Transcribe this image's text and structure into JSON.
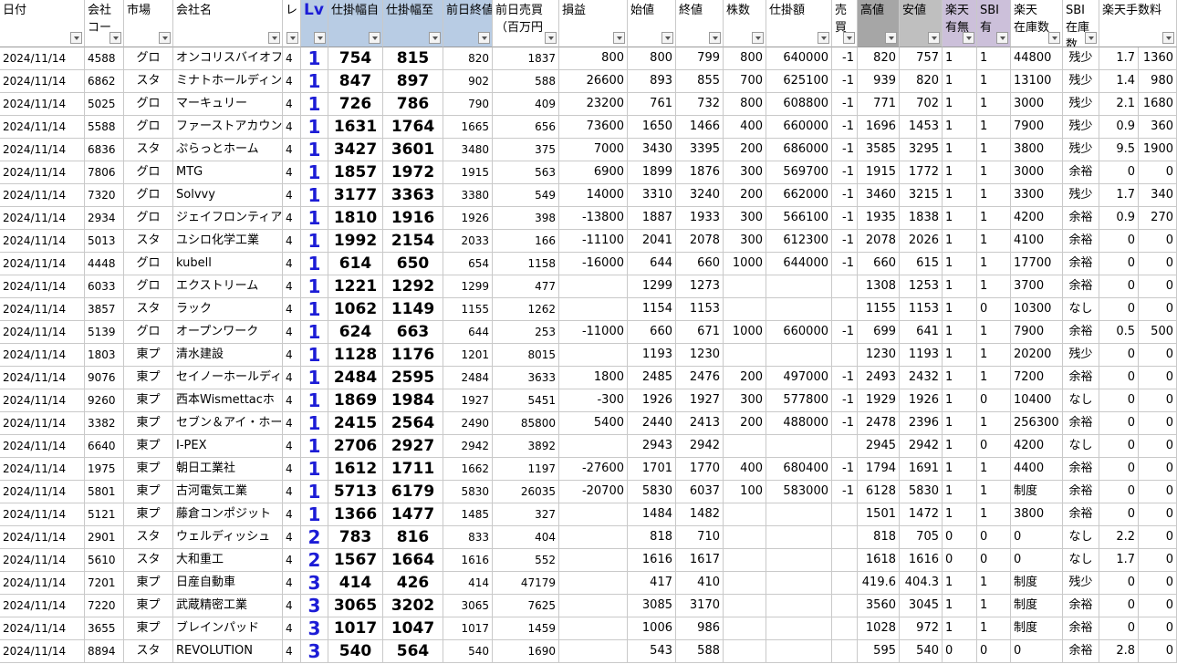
{
  "headers": [
    {
      "l1": "日付",
      "l2": ""
    },
    {
      "l1": "会社",
      "l2": "コー"
    },
    {
      "l1": "市場",
      "l2": ""
    },
    {
      "l1": "会社名",
      "l2": ""
    },
    {
      "l1": "レ",
      "l2": ""
    },
    {
      "l1": "Lv",
      "l2": ""
    },
    {
      "l1": "仕掛幅自",
      "l2": ""
    },
    {
      "l1": "仕掛幅至",
      "l2": ""
    },
    {
      "l1": "前日終値",
      "l2": ""
    },
    {
      "l1": "前日売買",
      "l2": "（百万円"
    },
    {
      "l1": "損益",
      "l2": ""
    },
    {
      "l1": "始値",
      "l2": ""
    },
    {
      "l1": "終値",
      "l2": ""
    },
    {
      "l1": "株数",
      "l2": ""
    },
    {
      "l1": "仕掛額",
      "l2": ""
    },
    {
      "l1": "売",
      "l2": "買"
    },
    {
      "l1": "高値",
      "l2": ""
    },
    {
      "l1": "安値",
      "l2": ""
    },
    {
      "l1": "楽天",
      "l2": "有無"
    },
    {
      "l1": "SBI",
      "l2": "有"
    },
    {
      "l1": "楽天",
      "l2": "在庫数"
    },
    {
      "l1": "SBI",
      "l2": "在庫",
      "l3": "数"
    },
    {
      "l1": "楽天手数料",
      "l2": ""
    }
  ],
  "rows": [
    [
      "2024/11/14",
      "4588",
      "グロ",
      "オンコリスバイオファ",
      "4",
      "1",
      "754",
      "815",
      "820",
      "1837",
      "800",
      "800",
      "799",
      "800",
      "640000",
      "-1",
      "820",
      "757",
      "1",
      "1",
      "44800",
      "残少",
      "1.7",
      "1360"
    ],
    [
      "2024/11/14",
      "6862",
      "スタ",
      "ミナトホールディン",
      "4",
      "1",
      "847",
      "897",
      "902",
      "588",
      "26600",
      "893",
      "855",
      "700",
      "625100",
      "-1",
      "939",
      "820",
      "1",
      "1",
      "13100",
      "残少",
      "1.4",
      "980"
    ],
    [
      "2024/11/14",
      "5025",
      "グロ",
      "マーキュリー",
      "4",
      "1",
      "726",
      "786",
      "790",
      "409",
      "23200",
      "761",
      "732",
      "800",
      "608800",
      "-1",
      "771",
      "702",
      "1",
      "1",
      "3000",
      "残少",
      "2.1",
      "1680"
    ],
    [
      "2024/11/14",
      "5588",
      "グロ",
      "ファーストアカウン",
      "4",
      "1",
      "1631",
      "1764",
      "1665",
      "656",
      "73600",
      "1650",
      "1466",
      "400",
      "660000",
      "-1",
      "1696",
      "1453",
      "1",
      "1",
      "7900",
      "残少",
      "0.9",
      "360"
    ],
    [
      "2024/11/14",
      "6836",
      "スタ",
      "ぷらっとホーム",
      "4",
      "1",
      "3427",
      "3601",
      "3480",
      "375",
      "7000",
      "3430",
      "3395",
      "200",
      "686000",
      "-1",
      "3585",
      "3295",
      "1",
      "1",
      "3800",
      "残少",
      "9.5",
      "1900"
    ],
    [
      "2024/11/14",
      "7806",
      "グロ",
      "MTG",
      "4",
      "1",
      "1857",
      "1972",
      "1915",
      "563",
      "6900",
      "1899",
      "1876",
      "300",
      "569700",
      "-1",
      "1915",
      "1772",
      "1",
      "1",
      "3000",
      "余裕",
      "0",
      "0"
    ],
    [
      "2024/11/14",
      "7320",
      "グロ",
      "Solvvy",
      "4",
      "1",
      "3177",
      "3363",
      "3380",
      "549",
      "14000",
      "3310",
      "3240",
      "200",
      "662000",
      "-1",
      "3460",
      "3215",
      "1",
      "1",
      "3300",
      "残少",
      "1.7",
      "340"
    ],
    [
      "2024/11/14",
      "2934",
      "グロ",
      "ジェイフロンティア",
      "4",
      "1",
      "1810",
      "1916",
      "1926",
      "398",
      "-13800",
      "1887",
      "1933",
      "300",
      "566100",
      "-1",
      "1935",
      "1838",
      "1",
      "1",
      "4200",
      "余裕",
      "0.9",
      "270"
    ],
    [
      "2024/11/14",
      "5013",
      "スタ",
      "ユシロ化学工業",
      "4",
      "1",
      "1992",
      "2154",
      "2033",
      "166",
      "-11100",
      "2041",
      "2078",
      "300",
      "612300",
      "-1",
      "2078",
      "2026",
      "1",
      "1",
      "4100",
      "余裕",
      "0",
      "0"
    ],
    [
      "2024/11/14",
      "4448",
      "グロ",
      "kubell",
      "4",
      "1",
      "614",
      "650",
      "654",
      "1158",
      "-16000",
      "644",
      "660",
      "1000",
      "644000",
      "-1",
      "660",
      "615",
      "1",
      "1",
      "17700",
      "余裕",
      "0",
      "0"
    ],
    [
      "2024/11/14",
      "6033",
      "グロ",
      "エクストリーム",
      "4",
      "1",
      "1221",
      "1292",
      "1299",
      "477",
      "",
      "1299",
      "1273",
      "",
      "",
      "",
      "1308",
      "1253",
      "1",
      "1",
      "3700",
      "余裕",
      "0",
      "0"
    ],
    [
      "2024/11/14",
      "3857",
      "スタ",
      "ラック",
      "4",
      "1",
      "1062",
      "1149",
      "1155",
      "1262",
      "",
      "1154",
      "1153",
      "",
      "",
      "",
      "1155",
      "1153",
      "1",
      "0",
      "10300",
      "なし",
      "0",
      "0"
    ],
    [
      "2024/11/14",
      "5139",
      "グロ",
      "オープンワーク",
      "4",
      "1",
      "624",
      "663",
      "644",
      "253",
      "-11000",
      "660",
      "671",
      "1000",
      "660000",
      "-1",
      "699",
      "641",
      "1",
      "1",
      "7900",
      "余裕",
      "0.5",
      "500"
    ],
    [
      "2024/11/14",
      "1803",
      "東プ",
      "清水建設",
      "4",
      "1",
      "1128",
      "1176",
      "1201",
      "8015",
      "",
      "1193",
      "1230",
      "",
      "",
      "",
      "1230",
      "1193",
      "1",
      "1",
      "20200",
      "残少",
      "0",
      "0"
    ],
    [
      "2024/11/14",
      "9076",
      "東プ",
      "セイノーホールディ",
      "4",
      "1",
      "2484",
      "2595",
      "2484",
      "3633",
      "1800",
      "2485",
      "2476",
      "200",
      "497000",
      "-1",
      "2493",
      "2432",
      "1",
      "1",
      "7200",
      "余裕",
      "0",
      "0"
    ],
    [
      "2024/11/14",
      "9260",
      "東プ",
      "西本Wismettacホ",
      "4",
      "1",
      "1869",
      "1984",
      "1927",
      "5451",
      "-300",
      "1926",
      "1927",
      "300",
      "577800",
      "-1",
      "1929",
      "1926",
      "1",
      "0",
      "10400",
      "なし",
      "0",
      "0"
    ],
    [
      "2024/11/14",
      "3382",
      "東プ",
      "セブン＆アイ・ホー",
      "4",
      "1",
      "2415",
      "2564",
      "2490",
      "85800",
      "5400",
      "2440",
      "2413",
      "200",
      "488000",
      "-1",
      "2478",
      "2396",
      "1",
      "1",
      "256300",
      "余裕",
      "0",
      "0"
    ],
    [
      "2024/11/14",
      "6640",
      "東プ",
      "I-PEX",
      "4",
      "1",
      "2706",
      "2927",
      "2942",
      "3892",
      "",
      "2943",
      "2942",
      "",
      "",
      "",
      "2945",
      "2942",
      "1",
      "0",
      "4200",
      "なし",
      "0",
      "0"
    ],
    [
      "2024/11/14",
      "1975",
      "東プ",
      "朝日工業社",
      "4",
      "1",
      "1612",
      "1711",
      "1662",
      "1197",
      "-27600",
      "1701",
      "1770",
      "400",
      "680400",
      "-1",
      "1794",
      "1691",
      "1",
      "1",
      "4400",
      "余裕",
      "0",
      "0"
    ],
    [
      "2024/11/14",
      "5801",
      "東プ",
      "古河電気工業",
      "4",
      "1",
      "5713",
      "6179",
      "5830",
      "26035",
      "-20700",
      "5830",
      "6037",
      "100",
      "583000",
      "-1",
      "6128",
      "5830",
      "1",
      "1",
      "制度",
      "余裕",
      "0",
      "0"
    ],
    [
      "2024/11/14",
      "5121",
      "東プ",
      "藤倉コンポジット",
      "4",
      "1",
      "1366",
      "1477",
      "1485",
      "327",
      "",
      "1484",
      "1482",
      "",
      "",
      "",
      "1501",
      "1472",
      "1",
      "1",
      "3800",
      "余裕",
      "0",
      "0"
    ],
    [
      "2024/11/14",
      "2901",
      "スタ",
      "ウェルディッシュ",
      "4",
      "2",
      "783",
      "816",
      "833",
      "404",
      "",
      "818",
      "710",
      "",
      "",
      "",
      "818",
      "705",
      "0",
      "0",
      "0",
      "なし",
      "2.2",
      "0"
    ],
    [
      "2024/11/14",
      "5610",
      "スタ",
      "大和重工",
      "4",
      "2",
      "1567",
      "1664",
      "1616",
      "552",
      "",
      "1616",
      "1617",
      "",
      "",
      "",
      "1618",
      "1616",
      "0",
      "0",
      "0",
      "なし",
      "1.7",
      "0"
    ],
    [
      "2024/11/14",
      "7201",
      "東プ",
      "日産自動車",
      "4",
      "3",
      "414",
      "426",
      "414",
      "47179",
      "",
      "417",
      "410",
      "",
      "",
      "",
      "419.6",
      "404.3",
      "1",
      "1",
      "制度",
      "残少",
      "0",
      "0"
    ],
    [
      "2024/11/14",
      "7220",
      "東プ",
      "武蔵精密工業",
      "4",
      "3",
      "3065",
      "3202",
      "3065",
      "7625",
      "",
      "3085",
      "3170",
      "",
      "",
      "",
      "3560",
      "3045",
      "1",
      "1",
      "制度",
      "余裕",
      "0",
      "0"
    ],
    [
      "2024/11/14",
      "3655",
      "東プ",
      "ブレインパッド",
      "4",
      "3",
      "1017",
      "1047",
      "1017",
      "1459",
      "",
      "1006",
      "986",
      "",
      "",
      "",
      "1028",
      "972",
      "1",
      "1",
      "制度",
      "余裕",
      "0",
      "0"
    ],
    [
      "2024/11/14",
      "8894",
      "スタ",
      "REVOLUTION",
      "4",
      "3",
      "540",
      "564",
      "540",
      "1690",
      "",
      "543",
      "588",
      "",
      "",
      "",
      "595",
      "540",
      "0",
      "0",
      "0",
      "余裕",
      "2.8",
      "0"
    ]
  ]
}
